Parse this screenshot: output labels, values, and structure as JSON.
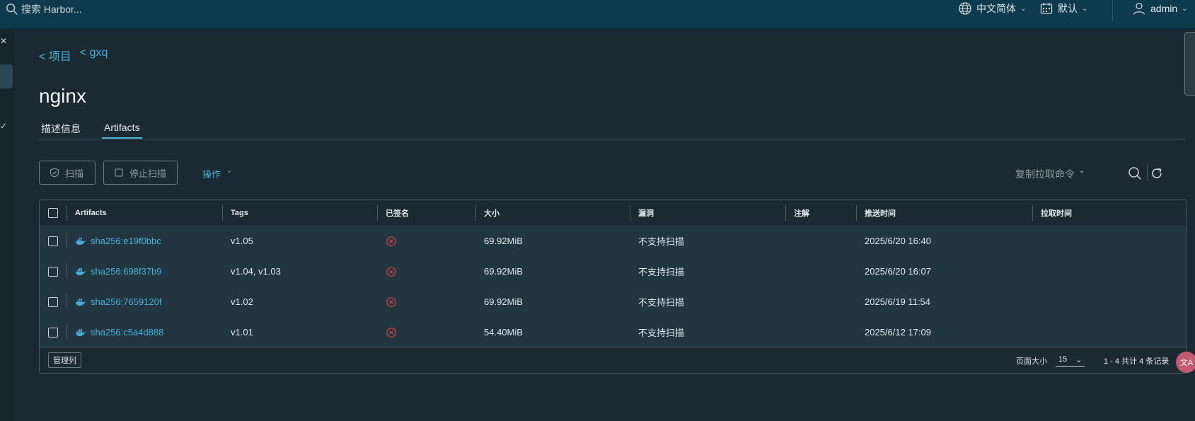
{
  "header": {
    "search_placeholder": "搜索 Harbor...",
    "language": "中文简体",
    "datetime_format": "默认",
    "user": "admin"
  },
  "breadcrumb": [
    "< 项目",
    "< gxq"
  ],
  "page_title": "nginx",
  "tabs": [
    {
      "label": "描述信息",
      "active": false
    },
    {
      "label": "Artifacts",
      "active": true
    }
  ],
  "toolbar": {
    "scan_label": "扫描",
    "stop_scan_label": "停止扫描",
    "actions_label": "操作",
    "copy_pull_label": "复制拉取命令"
  },
  "table": {
    "columns": [
      "Artifacts",
      "Tags",
      "已签名",
      "大小",
      "漏洞",
      "注解",
      "推送时间",
      "拉取时间"
    ],
    "rows": [
      {
        "artifact": "sha256:e19f0bbc",
        "tags": "v1.05",
        "size": "69.92MiB",
        "vuln": "不支持扫描",
        "annotation": "",
        "push_time": "2025/6/20 16:40",
        "pull_time": ""
      },
      {
        "artifact": "sha256:698f37b9",
        "tags": "v1.04, v1.03",
        "size": "69.92MiB",
        "vuln": "不支持扫描",
        "annotation": "",
        "push_time": "2025/6/20 16:07",
        "pull_time": ""
      },
      {
        "artifact": "sha256:7659120f",
        "tags": "v1.02",
        "size": "69.92MiB",
        "vuln": "不支持扫描",
        "annotation": "",
        "push_time": "2025/6/19 11:54",
        "pull_time": ""
      },
      {
        "artifact": "sha256:c5a4d888",
        "tags": "v1.01",
        "size": "54.40MiB",
        "vuln": "不支持扫描",
        "annotation": "",
        "push_time": "2025/6/12 17:09",
        "pull_time": ""
      }
    ]
  },
  "footer": {
    "manage_columns_label": "管理列",
    "page_size_label": "页面大小",
    "page_size_value": "15",
    "page_info": "1 - 4 共计 4 条记录"
  },
  "colors": {
    "accent": "#49afd9",
    "header_bg": "#0e3a4e",
    "page_bg": "#1b2a32",
    "unsigned_icon": "#e0433a"
  }
}
